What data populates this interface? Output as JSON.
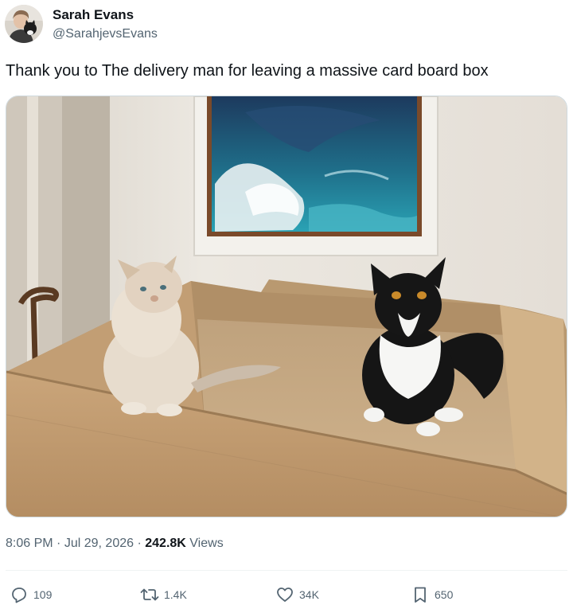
{
  "author": {
    "display_name": "Sarah Evans",
    "handle": "@SarahjevsEvans"
  },
  "tweet": {
    "text": "Thank you to The delivery man for leaving a massive card board box"
  },
  "media": {
    "kind": "photo",
    "subject": "two cats sitting in a large cardboard box beneath a painting of a wave"
  },
  "meta": {
    "time": "8:06 PM",
    "separator": "·",
    "date": "Jul 29, 2026",
    "views_count": "242.8K",
    "views_label": "Views"
  },
  "actions": {
    "replies": "109",
    "reposts": "1.4K",
    "likes": "34K",
    "bookmarks": "650"
  },
  "colors": {
    "text_primary": "#0f1419",
    "text_secondary": "#536471",
    "border": "#cfd9de",
    "divider": "#eff3f4"
  },
  "icons": {
    "reply": "reply-icon",
    "repost": "repost-icon",
    "like": "heart-icon",
    "bookmark": "bookmark-icon"
  }
}
